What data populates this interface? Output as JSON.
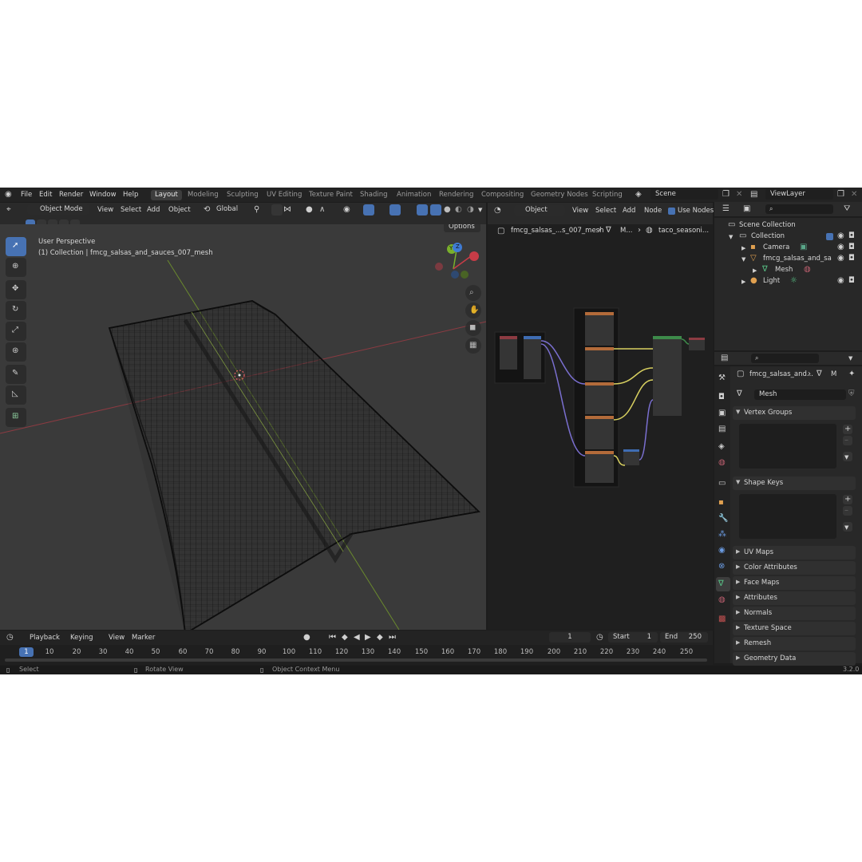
{
  "topbar": {
    "menu": [
      "File",
      "Edit",
      "Render",
      "Window",
      "Help"
    ],
    "workspaces": [
      "Layout",
      "Modeling",
      "Sculpting",
      "UV Editing",
      "Texture Paint",
      "Shading",
      "Animation",
      "Rendering",
      "Compositing",
      "Geometry Nodes",
      "Scripting"
    ],
    "active_workspace": "Layout",
    "scene": "Scene",
    "view_layer": "ViewLayer"
  },
  "viewport": {
    "mode": "Object Mode",
    "menus": [
      "View",
      "Select",
      "Add",
      "Object"
    ],
    "orientation": "Global",
    "options": "Options",
    "perspective": "User Perspective",
    "collection_line": "(1) Collection | fmcg_salsas_and_sauces_007_mesh",
    "gizmo_y": "Y",
    "gizmo_z": "Z"
  },
  "node_editor": {
    "object_dropdown": "Object",
    "menus": [
      "View",
      "Select",
      "Add",
      "Node"
    ],
    "use_nodes": "Use Nodes",
    "breadcrumb": [
      "fmcg_salsas_...s_007_mesh",
      "M...",
      "taco_seasoni..."
    ]
  },
  "outliner": {
    "root": "Scene Collection",
    "collection": "Collection",
    "items": [
      {
        "label": "Camera"
      },
      {
        "label": "fmcg_salsas_and_sa"
      },
      {
        "label": "Mesh"
      },
      {
        "label": "Light"
      }
    ]
  },
  "properties": {
    "breadcrumb_object": "fmcg_salsas_and...",
    "breadcrumb_data": "M",
    "mesh_name": "Mesh",
    "panels_open": [
      "Vertex Groups",
      "Shape Keys"
    ],
    "panels_closed": [
      "UV Maps",
      "Color Attributes",
      "Face Maps",
      "Attributes",
      "Normals",
      "Texture Space",
      "Remesh",
      "Geometry Data"
    ]
  },
  "timeline": {
    "menus": [
      "Playback",
      "Keying",
      "View",
      "Marker"
    ],
    "current_frame": "1",
    "start_label": "Start",
    "start_value": "1",
    "end_label": "End",
    "end_value": "250",
    "ruler": [
      "1",
      "10",
      "20",
      "30",
      "40",
      "50",
      "60",
      "70",
      "80",
      "90",
      "100",
      "110",
      "120",
      "130",
      "140",
      "150",
      "160",
      "170",
      "180",
      "190",
      "200",
      "210",
      "220",
      "230",
      "240",
      "250"
    ]
  },
  "status": {
    "select": "Select",
    "rotate": "Rotate View",
    "context": "Object Context Menu",
    "version": "3.2.0"
  },
  "colors": {
    "accent": "#4772b3",
    "x_axis": "#c73c47",
    "y_axis": "#7ab02b",
    "z_axis": "#3f7bd4",
    "viewport_bg": "#3a3a3a"
  }
}
